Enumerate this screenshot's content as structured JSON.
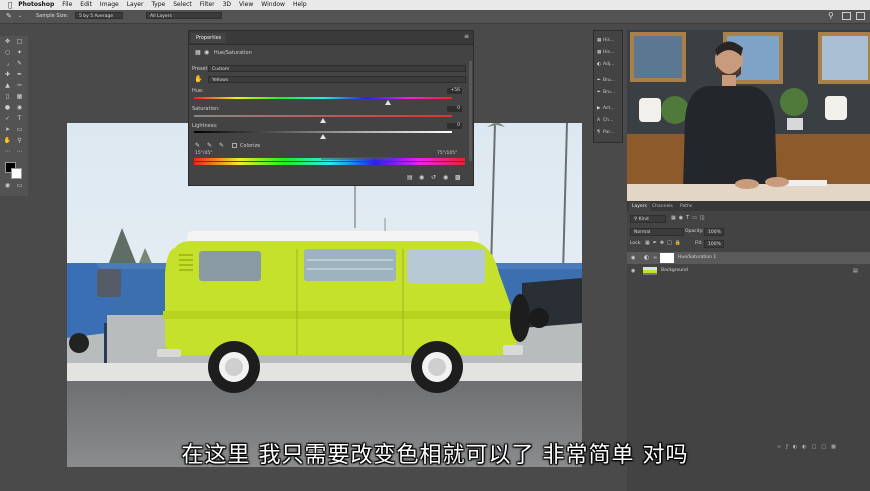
{
  "menubar": {
    "app": "Photoshop",
    "items": [
      "File",
      "Edit",
      "Image",
      "Layer",
      "Type",
      "Select",
      "Filter",
      "3D",
      "View",
      "Window",
      "Help"
    ]
  },
  "options_bar": {
    "sample_size_label": "Sample Size:",
    "sample_size_value": "5 by 5 Average",
    "sample_layers_value": "All Layers"
  },
  "properties_panel": {
    "tab_label": "Properties",
    "adjustment_name": "Hue/Saturation",
    "preset_label": "Preset:",
    "preset_value": "Custom",
    "channel_value": "Yellows",
    "hue_label": "Hue:",
    "hue_value": "+56",
    "saturation_label": "Saturation:",
    "saturation_value": "0",
    "lightness_label": "Lightness:",
    "lightness_value": "0",
    "colorize_label": "Colorize",
    "range_left": "15°/45°",
    "range_right": "75°/105°",
    "hue_fraction": 0.75,
    "saturation_fraction": 0.5,
    "lightness_fraction": 0.5
  },
  "side_panel": {
    "items": [
      "His...",
      "His...",
      "Adj...",
      "Bru...",
      "Bru...",
      "Act...",
      "Ch...",
      "Par..."
    ]
  },
  "layers_panel": {
    "tabs": [
      "Layers",
      "Channels",
      "Paths"
    ],
    "kind_label": "Kind",
    "blend_mode": "Normal",
    "opacity_label": "Opacity:",
    "opacity_value": "100%",
    "lock_label": "Lock:",
    "fill_label": "Fill:",
    "fill_value": "100%",
    "layers": [
      {
        "name": "Hue/Saturation 1"
      },
      {
        "name": "Background"
      }
    ]
  },
  "subtitle": "在这里 我只需要改变色相就可以了 非常简单 对吗",
  "colors": {
    "van_body": "#c6e12c",
    "ui_dark": "#434343",
    "ui_mid": "#535353"
  }
}
